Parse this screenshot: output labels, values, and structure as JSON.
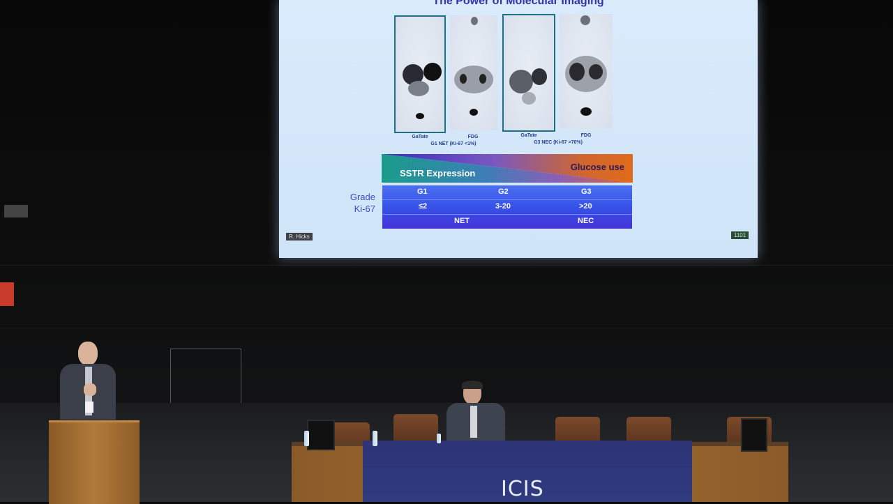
{
  "slide": {
    "title": "The Power of Molecular Imaging",
    "scans": [
      {
        "label": "GaTate"
      },
      {
        "label": "FDG"
      },
      {
        "label": "GaTate"
      },
      {
        "label": "FDG"
      }
    ],
    "group_captions": [
      "G1 NET  (Ki-67 <1%)",
      "G3  NEC (Ki-67 >70%)"
    ],
    "gradient": {
      "left_label": "SSTR Expression",
      "right_label": "Glucose use"
    },
    "row_labels": {
      "grade": "Grade",
      "ki67": "Ki-67"
    },
    "grade_table": {
      "grades": [
        "G1",
        "G2",
        "G3"
      ],
      "ki67": [
        "≤2",
        "3-20",
        ">20"
      ],
      "types": [
        "NET",
        "NEC"
      ]
    },
    "credit": "R. Hicks",
    "slide_number": "1101"
  },
  "stage": {
    "banner_text": "ICIS",
    "colors": {
      "screen": "#d9ebfb",
      "title": "#3432a8",
      "table_cloth": "#2c3474",
      "wood": "#a3702f"
    }
  }
}
